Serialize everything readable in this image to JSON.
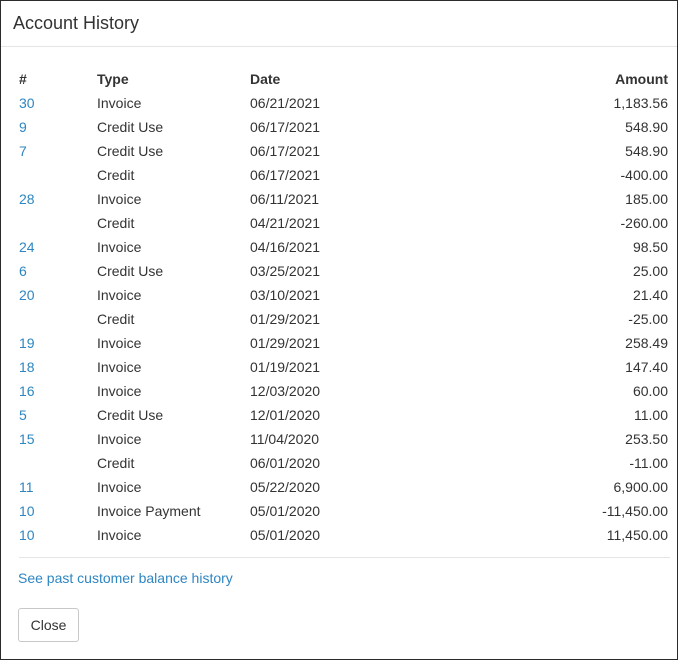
{
  "modal": {
    "title": "Account History"
  },
  "table": {
    "headers": {
      "num": "#",
      "type": "Type",
      "date": "Date",
      "amount": "Amount"
    },
    "rows": [
      {
        "num": "30",
        "type": "Invoice",
        "date": "06/21/2021",
        "amount": "1,183.56"
      },
      {
        "num": "9",
        "type": "Credit Use",
        "date": "06/17/2021",
        "amount": "548.90"
      },
      {
        "num": "7",
        "type": "Credit Use",
        "date": "06/17/2021",
        "amount": "548.90"
      },
      {
        "num": "",
        "type": "Credit",
        "date": "06/17/2021",
        "amount": "-400.00"
      },
      {
        "num": "28",
        "type": "Invoice",
        "date": "06/11/2021",
        "amount": "185.00"
      },
      {
        "num": "",
        "type": "Credit",
        "date": "04/21/2021",
        "amount": "-260.00"
      },
      {
        "num": "24",
        "type": "Invoice",
        "date": "04/16/2021",
        "amount": "98.50"
      },
      {
        "num": "6",
        "type": "Credit Use",
        "date": "03/25/2021",
        "amount": "25.00"
      },
      {
        "num": "20",
        "type": "Invoice",
        "date": "03/10/2021",
        "amount": "21.40"
      },
      {
        "num": "",
        "type": "Credit",
        "date": "01/29/2021",
        "amount": "-25.00"
      },
      {
        "num": "19",
        "type": "Invoice",
        "date": "01/29/2021",
        "amount": "258.49"
      },
      {
        "num": "18",
        "type": "Invoice",
        "date": "01/19/2021",
        "amount": "147.40"
      },
      {
        "num": "16",
        "type": "Invoice",
        "date": "12/03/2020",
        "amount": "60.00"
      },
      {
        "num": "5",
        "type": "Credit Use",
        "date": "12/01/2020",
        "amount": "11.00"
      },
      {
        "num": "15",
        "type": "Invoice",
        "date": "11/04/2020",
        "amount": "253.50"
      },
      {
        "num": "",
        "type": "Credit",
        "date": "06/01/2020",
        "amount": "-11.00"
      },
      {
        "num": "11",
        "type": "Invoice",
        "date": "05/22/2020",
        "amount": "6,900.00"
      },
      {
        "num": "10",
        "type": "Invoice Payment",
        "date": "05/01/2020",
        "amount": "-11,450.00"
      },
      {
        "num": "10",
        "type": "Invoice",
        "date": "05/01/2020",
        "amount": "11,450.00"
      }
    ]
  },
  "footer": {
    "past_link": "See past customer balance history",
    "close_label": "Close"
  },
  "colors": {
    "link": "#2e86c1",
    "text": "#333333",
    "divider": "#e5e5e5"
  }
}
